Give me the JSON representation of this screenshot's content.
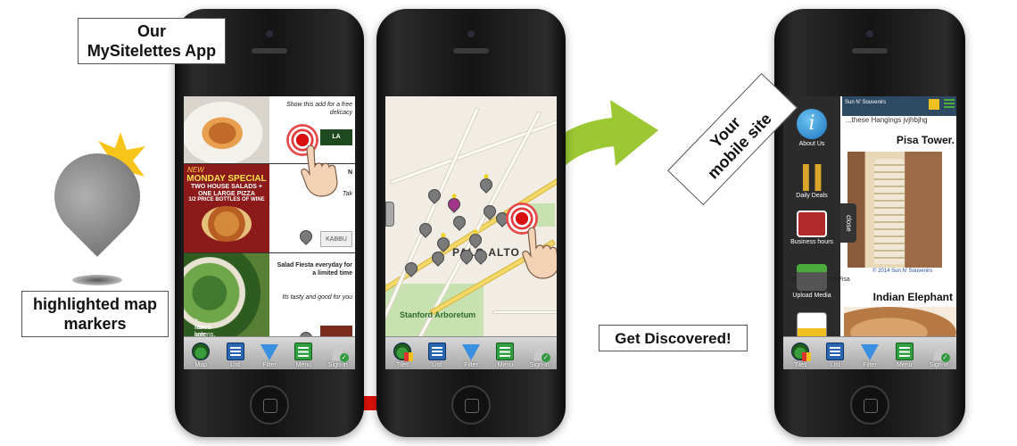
{
  "callouts": {
    "title_line1": "Our",
    "title_line2": "MySitelettes App",
    "markers_line1": "highlighted map",
    "markers_line2": "markers",
    "discover": "Get Discovered!",
    "mobile_line1": "Your",
    "mobile_line2": "mobile site"
  },
  "phone1": {
    "ads": [
      {
        "text": "Show this add for a free delicacy",
        "logo": "LA AMOUR"
      },
      {
        "photo_new": "NEW",
        "photo_title": "MONDAY SPECIAL",
        "photo_line1": "TWO HOUSE SALADS +",
        "photo_line2": "ONE LARGE PIZZA",
        "photo_line3": "1/2 PRICE BOTTLES OF WINE",
        "text_bold": "N",
        "text": "Tak",
        "logo": "KABBU"
      },
      {
        "text_bold": "Salad Fiesta everyday for a limited time",
        "text": "Its tasty and good for you",
        "photo_line1": "Mixed greens, tofu,",
        "photo_line2": "+ raw kale salad"
      }
    ],
    "tabs": [
      "Map",
      "List",
      "Filter",
      "Menu",
      "Sign-in"
    ]
  },
  "phone2": {
    "map_labels": {
      "city": "PALO ALTO",
      "arboretum": "Stanford Arboretum"
    },
    "tabs": [
      "Tiles",
      "List",
      "Filter",
      "Menu",
      "Sign-in"
    ]
  },
  "phone3": {
    "header": "Sun N' Souvenirs",
    "top_line": "...these Hangings jvjhbjhg",
    "heading1": "Pisa Tower.",
    "copyright": "© 2014 Sun N' Souvenirs",
    "caption": "Leaning Tower of Pisa",
    "heading2": "Indian Elephant",
    "menu": [
      "About Us",
      "Daily Deals",
      "Business hours",
      "Upload Media"
    ],
    "close": "close",
    "tabs": [
      "Tiles",
      "List",
      "Filter",
      "Menu",
      "Sign-in"
    ]
  },
  "colors": {
    "green_arrow": "#9cc833",
    "red_arrow": "#e3120b",
    "star": "#f7c51a",
    "marker": "#8a8a8a"
  }
}
